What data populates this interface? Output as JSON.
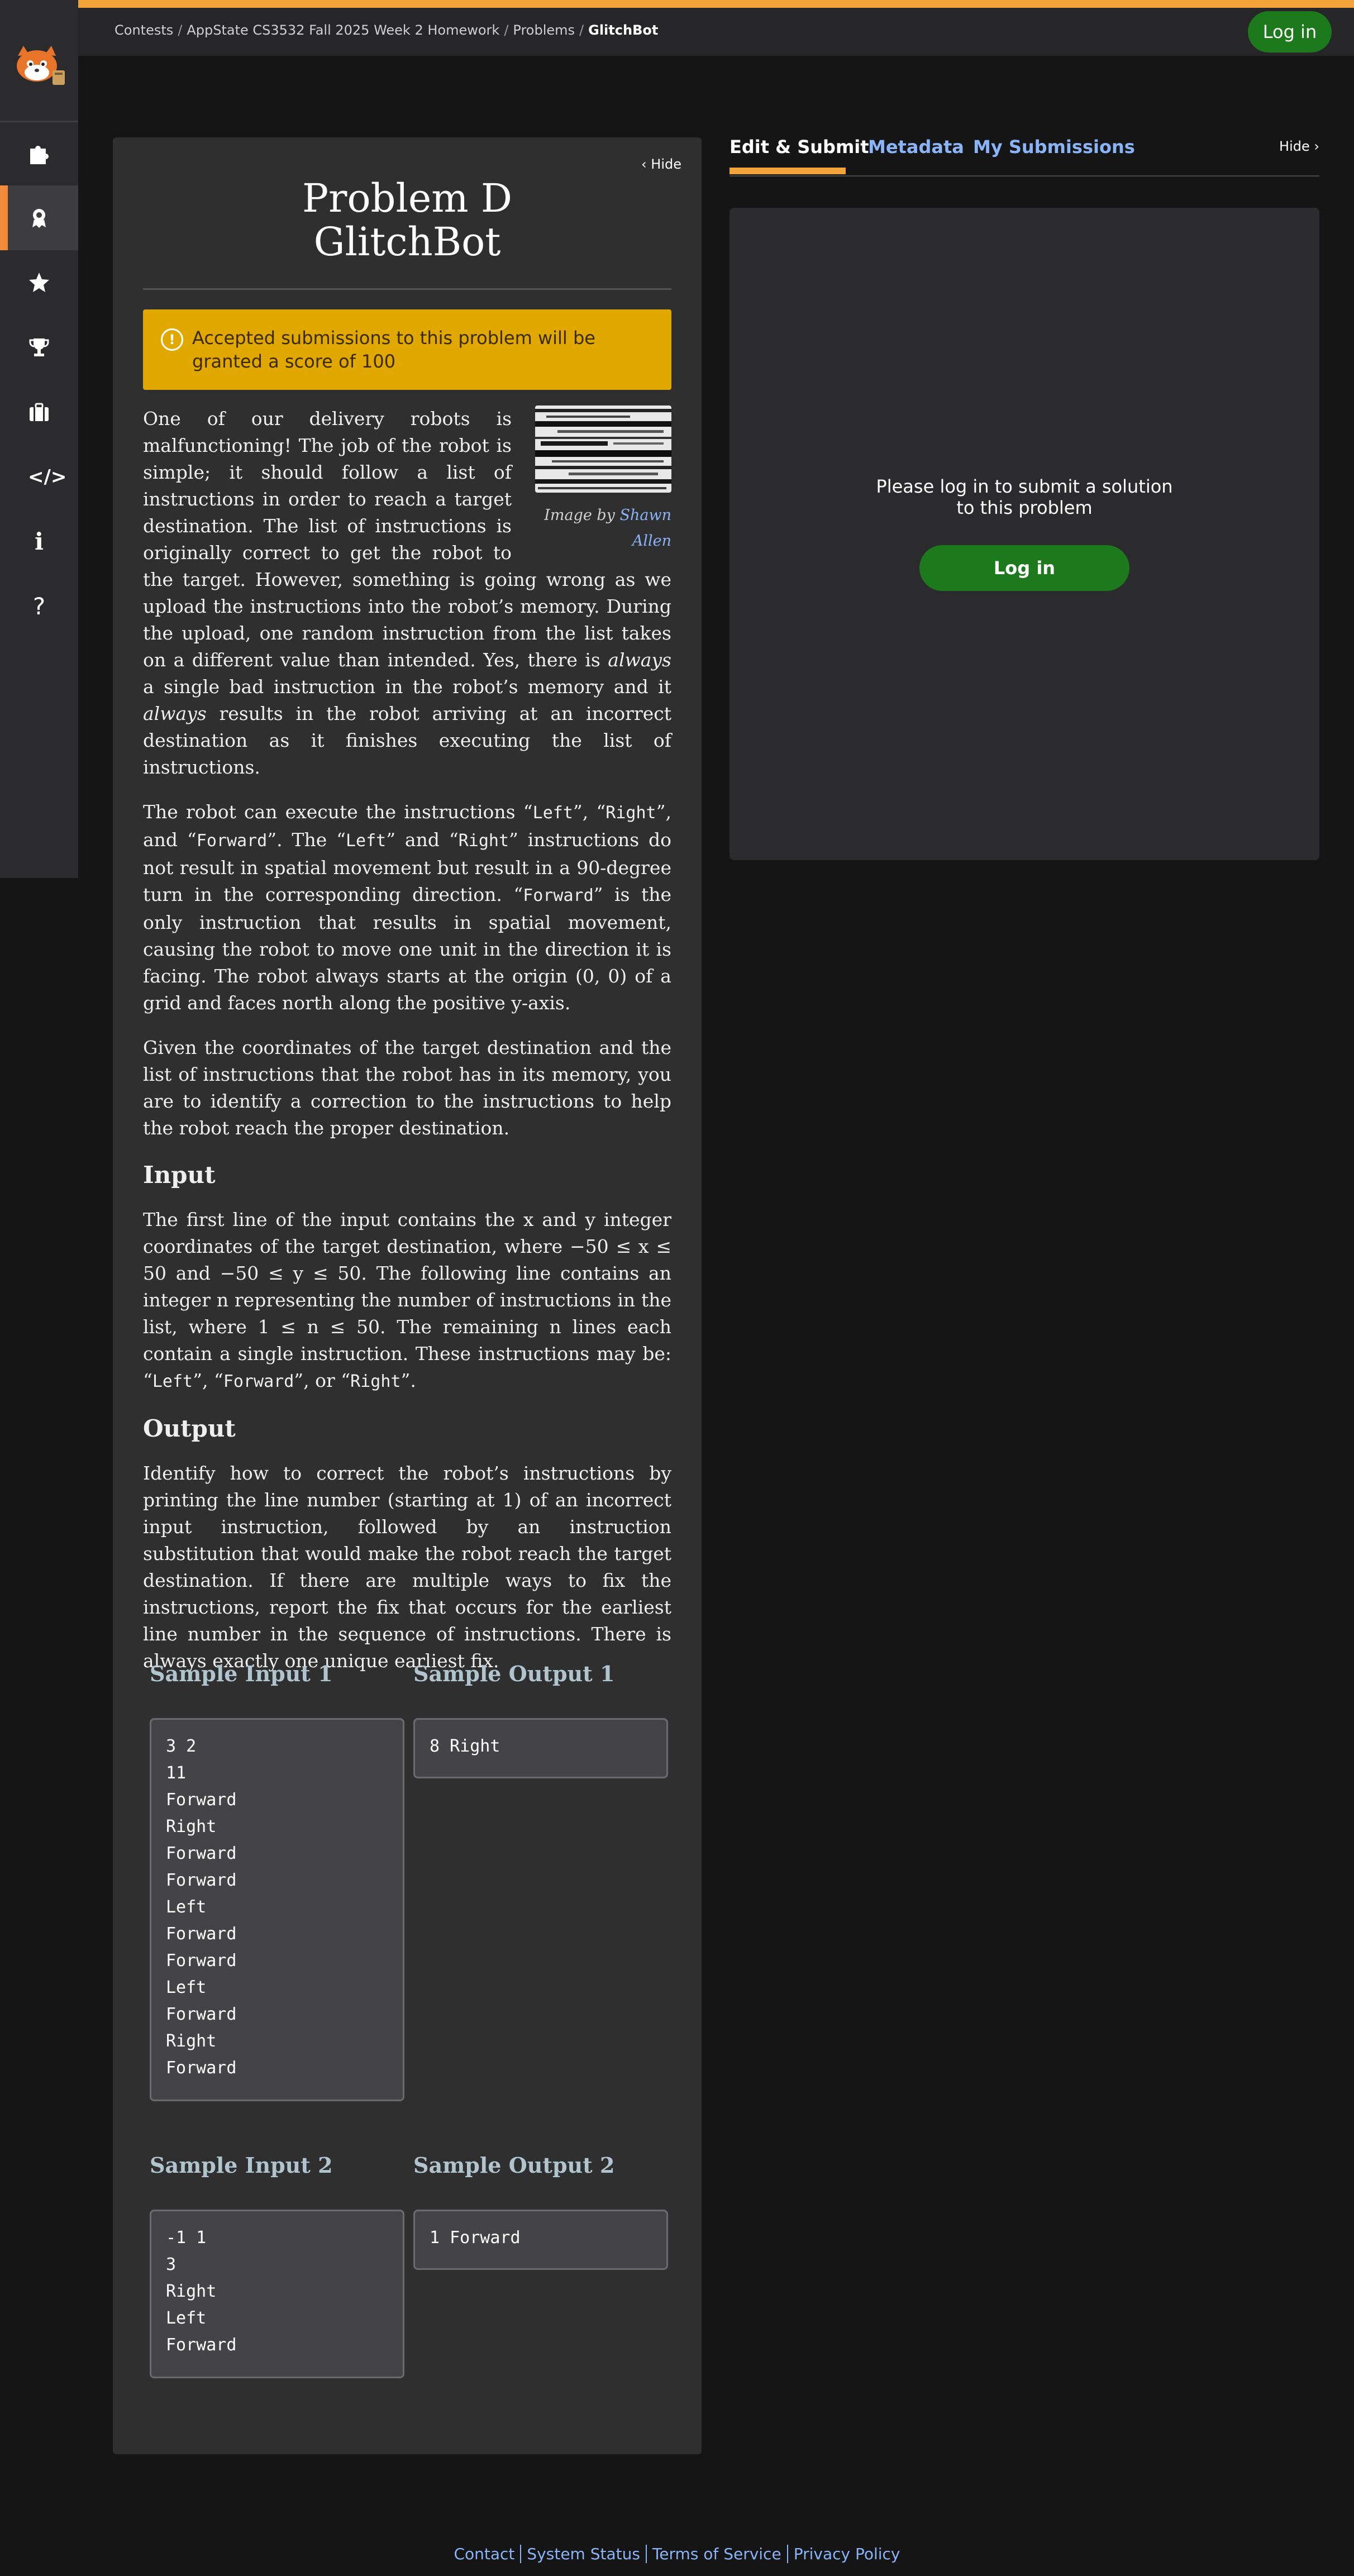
{
  "breadcrumb": [
    {
      "label": "Contests"
    },
    {
      "label": "AppState CS3532 Fall 2025 Week 2 Homework"
    },
    {
      "label": "Problems"
    },
    {
      "label": "GlitchBot"
    }
  ],
  "header": {
    "login_label": "Log in"
  },
  "sidebar": {
    "logo_alt": "Kattis cat logo",
    "items": [
      {
        "icon": "puzzle-icon"
      },
      {
        "icon": "badge-icon",
        "active": true
      },
      {
        "icon": "star-icon"
      },
      {
        "icon": "trophy-icon"
      },
      {
        "icon": "briefcase-icon"
      },
      {
        "icon": "code-icon",
        "text": "</>"
      },
      {
        "icon": "info-icon",
        "text": "i"
      },
      {
        "icon": "help-icon",
        "text": "?"
      }
    ]
  },
  "problem": {
    "hide_label": "Hide",
    "letter": "Problem D",
    "name": "GlitchBot",
    "alert": "Accepted submissions to this problem will be granted a score of 100",
    "image_caption_prefix": "Image by ",
    "image_author": "Shawn Allen",
    "para1_a": "One of our delivery robots is malfunctioning! The job of the robot is simple; it should follow a list of instructions in order to reach a target destination. The list of instructions is originally correct to get the robot to the target. However, something is going wrong as we upload the instructions into the robot’s memory. During the upload, one random instruction from the list takes on a different value than intended. Yes, there is ",
    "para1_always1": "always",
    "para1_b": " a single bad instruction in the robot’s memory and it ",
    "para1_always2": "always",
    "para1_c": " results in the robot arriving at an incorrect destination as it finishes executing the list of instructions.",
    "para2": [
      "The robot can execute the instructions “",
      "Left",
      "”, “",
      "Right",
      "”, and “",
      "Forward",
      "”. The “",
      "Left",
      "” and “",
      "Right",
      "” instructions do not result in spatial movement but result in a 90-degree turn in the corresponding direction. “",
      "Forward",
      "” is the only instruction that results in spatial movement, causing the robot to move one unit in the direction it is facing. The robot always starts at the origin (0, 0) of a grid and faces north along the positive y-axis."
    ],
    "para3": "Given the coordinates of the target destination and the list of instructions that the robot has in its memory, you are to identify a correction to the instructions to help the robot reach the proper destination.",
    "input_heading": "Input",
    "input_text_a": "The first line of the input contains the x and y integer coordinates of the target destination, where −50 ≤ x ≤ 50 and −50 ≤ y ≤ 50. The following line contains an integer n representing the number of instructions in the list, where 1 ≤ n ≤ 50. The remaining n lines each contain a single instruction. These instructions may be: “",
    "input_kw1": "Left",
    "input_text_b": "”, “",
    "input_kw2": "Forward",
    "input_text_c": "”, or “",
    "input_kw3": "Right",
    "input_text_d": "”.",
    "output_heading": "Output",
    "output_text": "Identify how to correct the robot’s instructions by printing the line number (starting at 1) of an incorrect input instruction, followed by an instruction substitution that would make the robot reach the target destination. If there are multiple ways to fix the instructions, report the fix that occurs for the earliest line number in the sequence of instructions. There is always exactly one unique earliest fix."
  },
  "samples": [
    {
      "input_label": "Sample Input 1",
      "output_label": "Sample Output 1",
      "input_lines": [
        "3 2",
        "11",
        "Forward",
        "Right",
        "Forward",
        "Forward",
        "Left",
        "Forward",
        "Forward",
        "Left",
        "Forward",
        "Right",
        "Forward"
      ],
      "output_lines": [
        "8 Right"
      ]
    },
    {
      "input_label": "Sample Input 2",
      "output_label": "Sample Output 2",
      "input_lines": [
        "-1 1",
        "3",
        "Right",
        "Left",
        "Forward"
      ],
      "output_lines": [
        "1 Forward"
      ]
    }
  ],
  "right_panel": {
    "tabs": [
      {
        "label": "Edit & Submit",
        "active": true
      },
      {
        "label": "Metadata"
      },
      {
        "label": "My Submissions"
      }
    ],
    "hide_label": "Hide",
    "login_message": "Please log in to submit a solution to this problem",
    "login_button": "Log in"
  },
  "footer": {
    "links": [
      "Contact",
      "System Status",
      "Terms of Service",
      "Privacy Policy"
    ]
  },
  "colors": {
    "accent": "#f2a43a",
    "active_nav": "#f28a3c",
    "login_green": "#1c7a1c",
    "link_blue": "#8ab4f8",
    "alert_yellow": "#e0a800"
  }
}
